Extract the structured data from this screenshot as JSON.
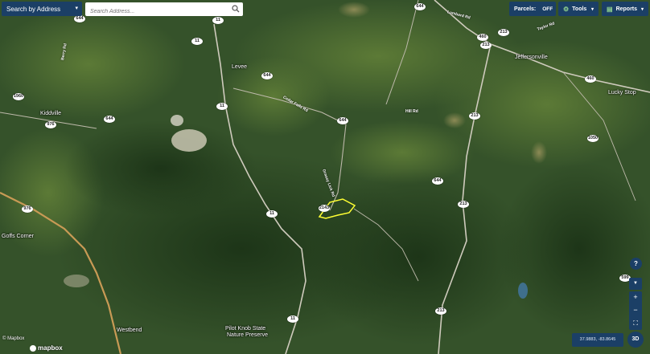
{
  "toolbar": {
    "search_by_label": "Search by Address",
    "search_placeholder": "Search Address...",
    "parcels_label": "Parcels:",
    "parcels_state": "OFF",
    "tools_label": "Tools",
    "reports_label": "Reports"
  },
  "map": {
    "places": [
      "Jeffersonville",
      "Lucky Stop",
      "Kiddville",
      "Goffs Corner",
      "Westbend",
      "Pilot Knob State",
      "Nature Preserve",
      "Levee"
    ],
    "road_labels": [
      "Lumbard Rd",
      "Taylor Rd",
      "Cedar Falls Rd",
      "Hill Rd",
      "Berry Rd",
      "Grassy Lick Rd"
    ],
    "route_shields": [
      "11",
      "11",
      "11",
      "11",
      "11",
      "644",
      "644",
      "644",
      "644",
      "644",
      "644",
      "1960",
      "976",
      "976",
      "213",
      "213",
      "213",
      "213",
      "213",
      "460",
      "460",
      "1050",
      "599",
      "2143"
    ],
    "overlay_color": "#ffff33"
  },
  "controls": {
    "help": "?",
    "layers": "▼",
    "zoom_in": "+",
    "zoom_out": "−",
    "fullscreen": "⛶",
    "coords": "37.9883, -83.8645",
    "btn_3d": "3D"
  },
  "attribution": {
    "copyright": "© Mapbox",
    "logo_text": "mapbox"
  }
}
